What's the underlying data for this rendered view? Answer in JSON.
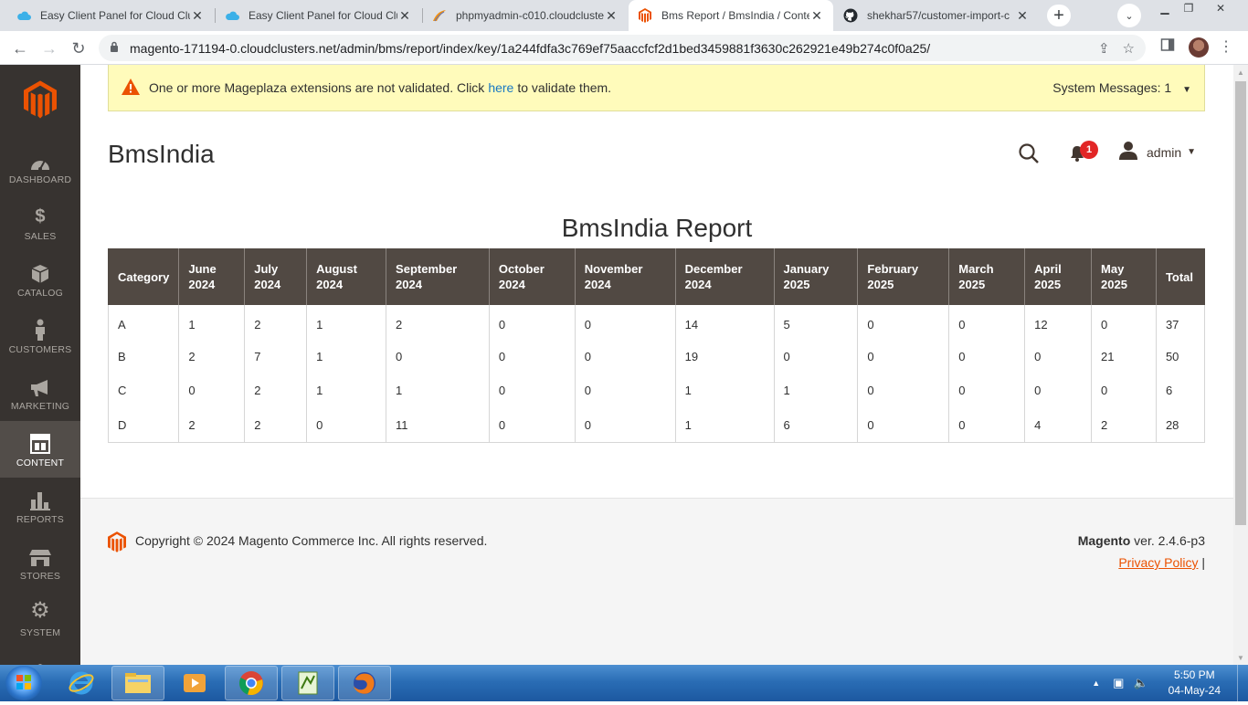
{
  "browser": {
    "tabs": [
      {
        "title": "Easy Client Panel for Cloud Clu",
        "icon": "cloud-icon"
      },
      {
        "title": "Easy Client Panel for Cloud Clu",
        "icon": "cloud-icon"
      },
      {
        "title": "phpmyadmin-c010.cloudcluste",
        "icon": "phpmyadmin-icon"
      },
      {
        "title": "Bms Report / BmsIndia / Conte",
        "icon": "magento-icon"
      },
      {
        "title": "shekhar57/customer-import-c",
        "icon": "github-icon"
      }
    ],
    "url_domain": "magento-171194-0.cloudclusters.net",
    "url_path": "/admin/bms/report/index/key/1a244fdfa3c769ef75aaccfcf2d1bed3459881f3630c262921e49b274c0f0a25/"
  },
  "sidebar": {
    "items": [
      {
        "label": "DASHBOARD",
        "icon": "dashboard-icon"
      },
      {
        "label": "SALES",
        "icon": "dollar-icon"
      },
      {
        "label": "CATALOG",
        "icon": "box-icon"
      },
      {
        "label": "CUSTOMERS",
        "icon": "person-icon"
      },
      {
        "label": "MARKETING",
        "icon": "megaphone-icon"
      },
      {
        "label": "CONTENT",
        "icon": "layout-icon"
      },
      {
        "label": "REPORTS",
        "icon": "bar-chart-icon"
      },
      {
        "label": "STORES",
        "icon": "store-icon"
      },
      {
        "label": "SYSTEM",
        "icon": "gear-icon"
      }
    ],
    "active": "CONTENT"
  },
  "system_message": {
    "text_before": "One or more Mageplaza extensions are not validated. Click",
    "link": "here",
    "text_after": "to validate them.",
    "count_label": "System Messages: 1"
  },
  "header": {
    "title": "BmsIndia",
    "notification_count": "1",
    "user": "admin"
  },
  "report": {
    "title": "BmsIndia Report",
    "columns": [
      "Category",
      "June 2024",
      "July 2024",
      "August 2024",
      "September 2024",
      "October 2024",
      "November 2024",
      "December 2024",
      "January 2025",
      "February 2025",
      "March 2025",
      "April 2025",
      "May 2025",
      "Total"
    ],
    "rows": [
      [
        "A",
        "1",
        "2",
        "1",
        "2",
        "0",
        "0",
        "14",
        "5",
        "0",
        "0",
        "12",
        "0",
        "37"
      ],
      [
        "B",
        "2",
        "7",
        "1",
        "0",
        "0",
        "0",
        "19",
        "0",
        "0",
        "0",
        "0",
        "21",
        "50"
      ],
      [
        "C",
        "0",
        "2",
        "1",
        "1",
        "0",
        "0",
        "1",
        "1",
        "0",
        "0",
        "0",
        "0",
        "6"
      ],
      [
        "D",
        "2",
        "2",
        "0",
        "11",
        "0",
        "0",
        "1",
        "6",
        "0",
        "0",
        "4",
        "2",
        "28"
      ]
    ]
  },
  "footer": {
    "copyright": "Copyright © 2024 Magento Commerce Inc. All rights reserved.",
    "brand": "Magento",
    "version": "ver. 2.4.6-p3",
    "privacy": "Privacy Policy",
    "separator": "|"
  },
  "taskbar": {
    "time": "5:50 PM",
    "date": "04-May-24"
  },
  "colors": {
    "magento_orange": "#eb5202",
    "sidebar_bg": "#373330",
    "table_header_bg": "#514943",
    "message_bg": "#fffbbb"
  }
}
